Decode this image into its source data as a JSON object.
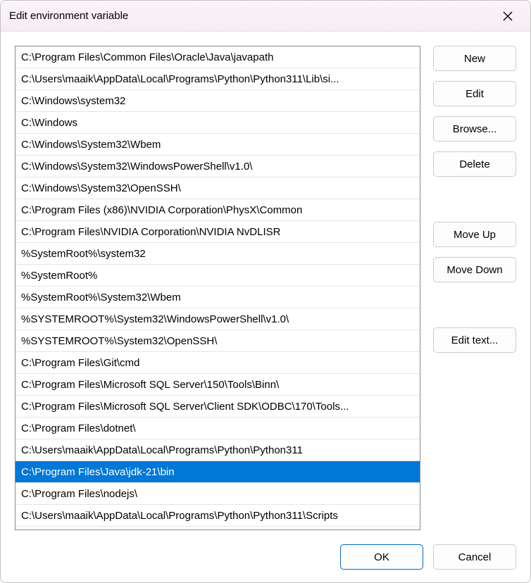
{
  "title": "Edit environment variable",
  "entries": [
    "C:\\Program Files\\Common Files\\Oracle\\Java\\javapath",
    "C:\\Users\\maaik\\AppData\\Local\\Programs\\Python\\Python311\\Lib\\si...",
    "C:\\Windows\\system32",
    "C:\\Windows",
    "C:\\Windows\\System32\\Wbem",
    "C:\\Windows\\System32\\WindowsPowerShell\\v1.0\\",
    "C:\\Windows\\System32\\OpenSSH\\",
    "C:\\Program Files (x86)\\NVIDIA Corporation\\PhysX\\Common",
    "C:\\Program Files\\NVIDIA Corporation\\NVIDIA NvDLISR",
    "%SystemRoot%\\system32",
    "%SystemRoot%",
    "%SystemRoot%\\System32\\Wbem",
    "%SYSTEMROOT%\\System32\\WindowsPowerShell\\v1.0\\",
    "%SYSTEMROOT%\\System32\\OpenSSH\\",
    "C:\\Program Files\\Git\\cmd",
    "C:\\Program Files\\Microsoft SQL Server\\150\\Tools\\Binn\\",
    "C:\\Program Files\\Microsoft SQL Server\\Client SDK\\ODBC\\170\\Tools...",
    "C:\\Program Files\\dotnet\\",
    "C:\\Users\\maaik\\AppData\\Local\\Programs\\Python\\Python311",
    "C:\\Program Files\\Java\\jdk-21\\bin",
    "C:\\Program Files\\nodejs\\",
    "C:\\Users\\maaik\\AppData\\Local\\Programs\\Python\\Python311\\Scripts"
  ],
  "selected_index": 19,
  "buttons": {
    "new": "New",
    "edit": "Edit",
    "browse": "Browse...",
    "delete": "Delete",
    "moveup": "Move Up",
    "movedown": "Move Down",
    "edittext": "Edit text...",
    "ok": "OK",
    "cancel": "Cancel"
  }
}
